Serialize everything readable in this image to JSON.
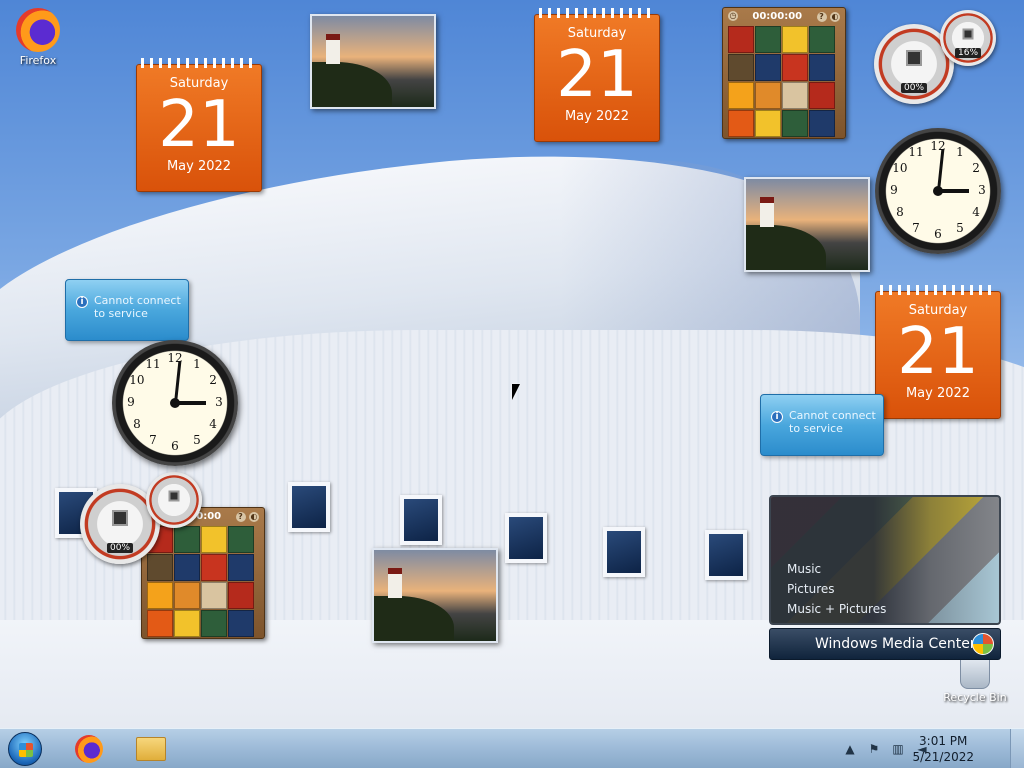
{
  "desktop": {
    "icons": [
      {
        "label": "Firefox"
      },
      {
        "label": "Recycle Bin"
      }
    ]
  },
  "calendar": {
    "weekday": "Saturday",
    "day": "21",
    "month_year": "May 2022"
  },
  "puzzle": {
    "timer": "00:00:00",
    "tile_colors": [
      "#b52a1c",
      "#2e5e3a",
      "#f2c22b",
      "#2e5e3a",
      "#5f4a2e",
      "#1f3a6a",
      "#c8341f",
      "#1f3a6a",
      "#f4a21b",
      "#e08a2a",
      "#d9c4a0",
      "#b52a1c",
      "#e35a16",
      "#f2c22b",
      "#2e5e3a",
      "#1f3a6a"
    ]
  },
  "cpu_meter": {
    "cpu": "00%",
    "memory": "16%"
  },
  "weather": {
    "message": "Cannot connect to service"
  },
  "media_center": {
    "menu": [
      "Music",
      "Pictures",
      "Music + Pictures"
    ],
    "bar_title": "Windows Media Center"
  },
  "clock": {
    "numbers": [
      "12",
      "1",
      "2",
      "3",
      "4",
      "5",
      "6",
      "7",
      "8",
      "9",
      "10",
      "11"
    ]
  },
  "taskbar": {
    "time": "3:01 PM",
    "date": "5/21/2022"
  }
}
